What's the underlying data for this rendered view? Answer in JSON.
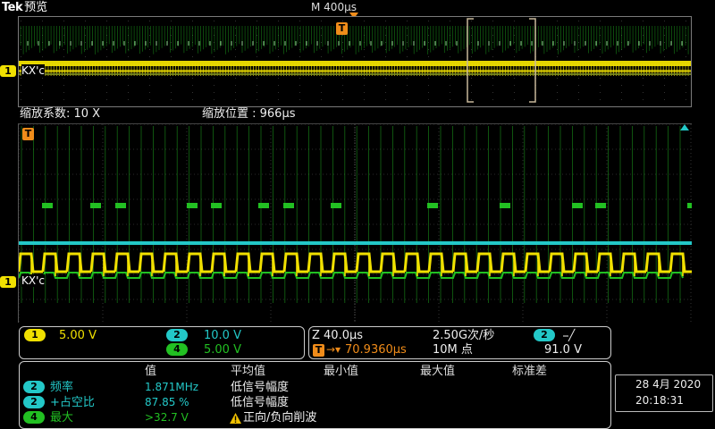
{
  "header": {
    "brand": "Tek",
    "mode": "预览",
    "timebase": "M 400µs"
  },
  "overview": {
    "ch1_label": "KX'c"
  },
  "zoom": {
    "factor_label": "缩放系数: 10 X",
    "position_label": "缩放位置 :  966µs",
    "ch1_label": "KX'c"
  },
  "channels": {
    "ch1": {
      "num": "1",
      "scale": "5.00 V",
      "color": "#f0e000"
    },
    "ch2": {
      "num": "2",
      "scale": "10.0 V",
      "color": "#23c8c8"
    },
    "ch4": {
      "num": "4",
      "scale": "5.00 V",
      "color": "#22c022"
    }
  },
  "acq": {
    "zoom_time": "Z 40.0µs",
    "sample_rate": "2.50G次/秒",
    "trigger_offset": "70.9360µs",
    "record_length": "10M 点",
    "trig_source": "2",
    "trig_slope": "⎯╱",
    "trig_level": "91.0 V"
  },
  "measurements": {
    "headers": [
      "值",
      "平均值",
      "最小值",
      "最大值",
      "标准差"
    ],
    "rows": [
      {
        "ch": "2",
        "name": "频率",
        "value": "1.871MHz",
        "note": "低信号幅度",
        "color": "#23c8c8"
      },
      {
        "ch": "2",
        "name": "+占空比",
        "value": "87.85 %",
        "note": "低信号幅度",
        "color": "#23c8c8"
      },
      {
        "ch": "4",
        "name": "最大",
        "value": ">32.7 V",
        "note": "正向/负向削波",
        "color": "#22c022"
      }
    ]
  },
  "datetime": {
    "date": "28 4月 2020",
    "time": "20:18:31"
  },
  "colors": {
    "ch1": "#f0e000",
    "ch2": "#23c8c8",
    "ch4": "#22c022",
    "trigger": "#f08c1a",
    "warning": "#f0c000"
  },
  "icons": {
    "trigger_marker": "T",
    "warning": "warning-icon"
  }
}
